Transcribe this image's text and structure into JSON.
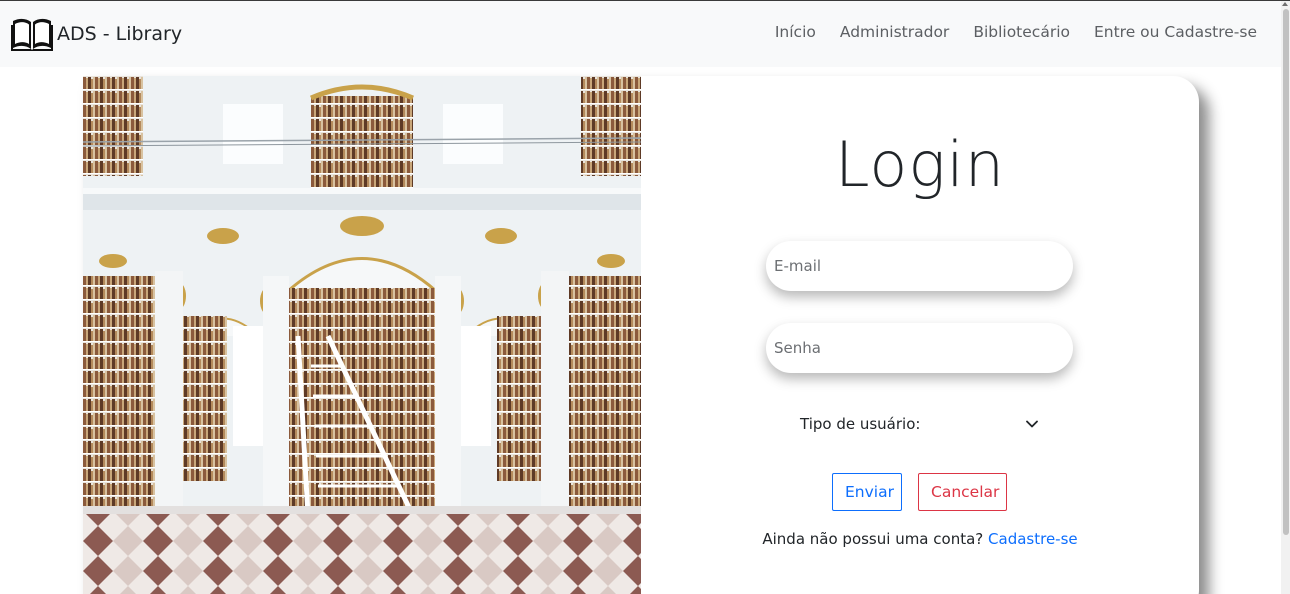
{
  "navbar": {
    "brand": "ADS - Library",
    "links": [
      "Início",
      "Administrador",
      "Bibliotecário",
      "Entre ou Cadastre-se"
    ]
  },
  "login": {
    "title": "Login",
    "email_placeholder": "E-mail",
    "password_placeholder": "Senha",
    "user_type_label": "Tipo de usuário:",
    "submit_label": "Enviar",
    "cancel_label": "Cancelar",
    "signup_prompt": "Ainda não possui uma conta?",
    "signup_link": "Cadastre-se"
  },
  "colors": {
    "primary": "#0d6efd",
    "danger": "#dc3545",
    "navbar_bg": "#f8f9fa",
    "text": "#212529"
  },
  "icons": {
    "brand": "open-book-icon",
    "select": "chevron-down-icon"
  }
}
